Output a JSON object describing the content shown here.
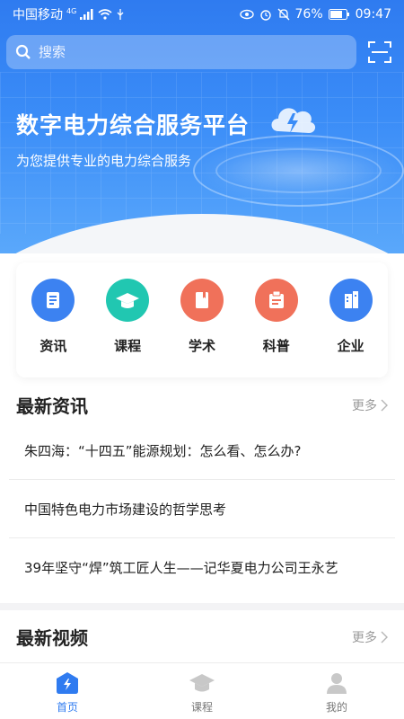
{
  "status_bar": {
    "carrier": "中国移动",
    "network": "4G",
    "battery": "76%",
    "time": "09:47"
  },
  "search": {
    "placeholder": "搜索"
  },
  "banner": {
    "title": "数字电力综合服务平台",
    "subtitle": "为您提供专业的电力综合服务",
    "dots_total": 4,
    "dots_active": 1
  },
  "categories": [
    {
      "label": "资讯",
      "icon": "news-doc-icon",
      "color": "#3c82f1"
    },
    {
      "label": "课程",
      "icon": "graduation-cap-icon",
      "color": "#21c7b1"
    },
    {
      "label": "学术",
      "icon": "book-icon",
      "color": "#f0715a"
    },
    {
      "label": "科普",
      "icon": "clipboard-icon",
      "color": "#f0715a"
    },
    {
      "label": "企业",
      "icon": "building-icon",
      "color": "#3c82f1"
    }
  ],
  "latest_news": {
    "title": "最新资讯",
    "more": "更多",
    "items": [
      "朱四海：“十四五”能源规划：怎么看、怎么办?",
      "中国特色电力市场建设的哲学思考",
      "39年坚守“焊”筑工匠人生——记华夏电力公司王永艺"
    ]
  },
  "latest_videos": {
    "title": "最新视频",
    "more": "更多"
  },
  "tabbar": {
    "items": [
      {
        "label": "首页",
        "icon": "home-bolt-icon",
        "active": true
      },
      {
        "label": "课程",
        "icon": "graduation-cap-icon",
        "active": false
      },
      {
        "label": "我的",
        "icon": "user-icon",
        "active": false
      }
    ],
    "active_color": "#2f7bf0",
    "inactive_color": "#c8c8c8"
  }
}
